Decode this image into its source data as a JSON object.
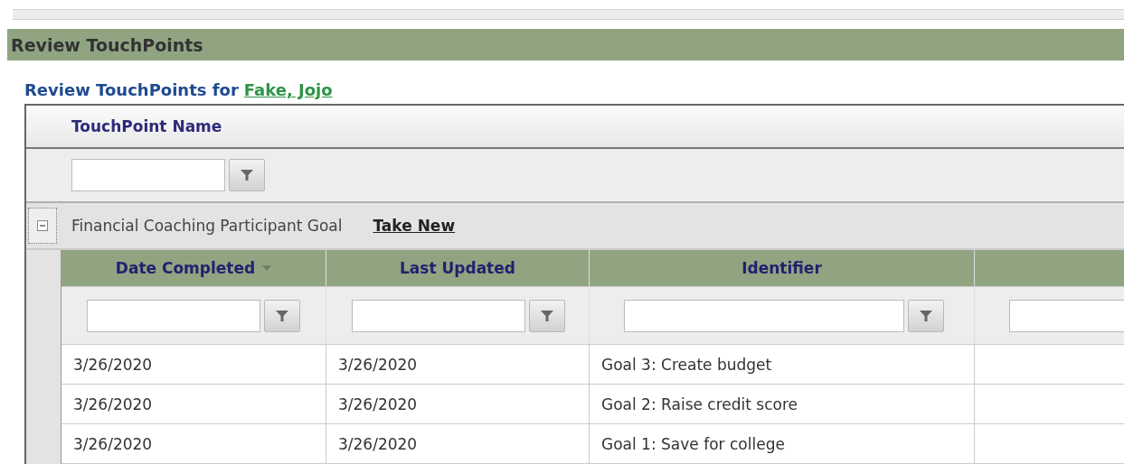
{
  "panel": {
    "title": "Review TouchPoints"
  },
  "subtitle": {
    "text": "Review TouchPoints for",
    "link": "Fake, Jojo"
  },
  "outer_grid": {
    "column": "TouchPoint Name",
    "group": {
      "name": "Financial Coaching Participant Goal",
      "action": "Take New",
      "expanded": true
    }
  },
  "table": {
    "columns": [
      {
        "label": "Date Completed",
        "sorted": true
      },
      {
        "label": "Last Updated",
        "sorted": false
      },
      {
        "label": "Identifier",
        "sorted": false
      },
      {
        "sorted": false
      }
    ],
    "rows": [
      [
        "3/26/2020",
        "3/26/2020",
        "Goal 3: Create budget"
      ],
      [
        "3/26/2020",
        "3/26/2020",
        "Goal 2: Raise credit score"
      ],
      [
        "3/26/2020",
        "3/26/2020",
        "Goal 1: Save for college"
      ]
    ]
  }
}
